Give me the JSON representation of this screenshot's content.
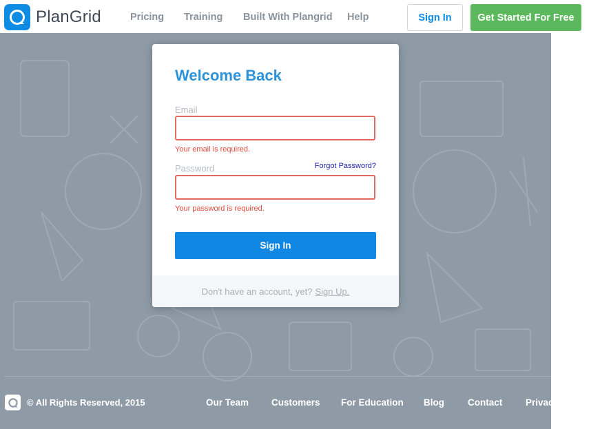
{
  "header": {
    "brand": "PlanGrid",
    "nav": [
      "Pricing",
      "Training",
      "Built With Plangrid",
      "Help"
    ],
    "sign_in": "Sign In",
    "get_started": "Get Started For Free"
  },
  "login": {
    "title": "Welcome Back",
    "email_label": "Email",
    "email_value": "",
    "email_error": "Your email is required.",
    "password_label": "Password",
    "password_value": "",
    "forgot": "Forgot Password?",
    "password_error": "Your password is required.",
    "submit": "Sign In",
    "no_account": "Don't have an account, yet?",
    "sign_up": "Sign Up."
  },
  "footer": {
    "copyright": "© All Rights Reserved, 2015",
    "links": [
      "Our Team",
      "Customers",
      "For Education",
      "Blog",
      "Contact",
      "Privacy"
    ]
  },
  "colors": {
    "brand_blue": "#0e8ce4",
    "cta_green": "#5cb85c",
    "error_red": "#e16a5f",
    "background": "#8e9ba7"
  },
  "icons": {
    "logo": "plangrid-logo-icon",
    "footer_logo": "plangrid-logo-icon"
  }
}
